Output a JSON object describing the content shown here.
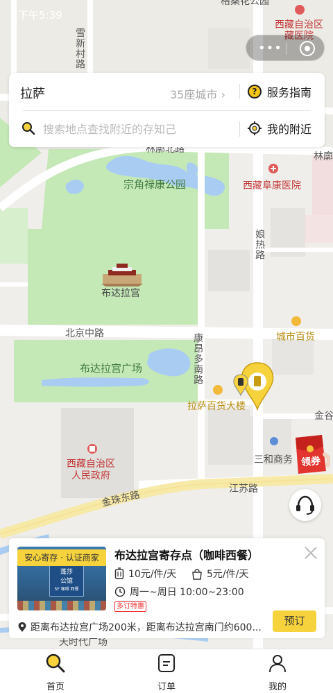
{
  "status": {
    "time": "下午5:39"
  },
  "search": {
    "city": "拉萨",
    "city_count": "35座城市",
    "guide_label": "服务指南",
    "placeholder": "搜索地点查找附近的存知己",
    "nearby_label": "我的附近"
  },
  "map": {
    "labels": {
      "park": "宗角禄康公园",
      "potala": "布达拉宫",
      "square": "布达拉宫广场",
      "hospital_top": "西藏自治区藏医院",
      "hospital_top_line1": "西藏自治区",
      "hospital_top_line2": "藏医院",
      "hospital_fk": "西藏阜康医院",
      "gov_line1": "西藏自治区",
      "gov_line2": "人民政府",
      "beijing_road": "北京中路",
      "jiangsu_road": "江苏路",
      "jinzhu_road": "金珠东路",
      "kangang_road": "康昂多南路",
      "niangre_road": "娘热路",
      "xuexin_road": "雪新村路",
      "linkuo_north": "林廓北路",
      "linkuo": "林廓",
      "city_store": "城市百货",
      "lhasa_store": "拉萨百货大楼",
      "sanhe": "三和商务",
      "jingu": "金谷",
      "times_square": "天时代广场",
      "top_park": "格桑花公园"
    }
  },
  "coupon_label": "领券",
  "store": {
    "badge": "安心寄存 · 认证商家",
    "name": "布达拉宫寄存点（咖啡西餐）",
    "price_small": "10元/件/天",
    "price_bag": "5元/件/天",
    "hours": "周一~周日 10:00~23:00",
    "promo": "多订特惠",
    "distance": "距离布达拉宫广场200米，距离布达拉宫南门约600...",
    "book_button": "预订",
    "photo_sign_line1": "蓬莎",
    "photo_sign_line2": "公馆",
    "photo_sign_line3": "5F 咖啡 西餐"
  },
  "tabs": [
    {
      "label": "首页",
      "icon": "search-icon",
      "active": true
    },
    {
      "label": "订单",
      "icon": "order-icon",
      "active": false
    },
    {
      "label": "我的",
      "icon": "user-icon",
      "active": false
    }
  ],
  "colors": {
    "accent": "#f6d33d",
    "park_green": "#c5e8b7",
    "water": "#a9cdf2",
    "map_bg": "#efeeea"
  }
}
